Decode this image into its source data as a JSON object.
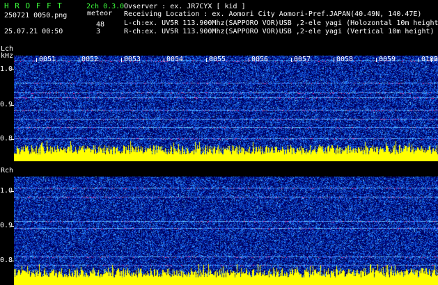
{
  "header": {
    "brand": "H R O F F T",
    "mode": "2ch 0.3.0",
    "filename": "250721 0050.png",
    "meteor_label": "meteor",
    "meteor_count_l": "48",
    "meteor_count_r": "3",
    "datetime": "25.07.21 00:50",
    "observer_line": "Ovserver              : ex. JR7CYX [ kid ]",
    "location_line": "Receiving Location : ex. Aomori City Aomori-Pref.JAPAN(40.49N, 140.47E)",
    "lch_line": "L-ch:ex. UV5R 113.900Mhz(SAPPORO VOR)USB ,2-ele yagi (Holozontal 10m height",
    "rch_line": "R-ch:ex. UV5R 113.900Mhz(SAPPORO VOR)USB ,2-ele yagi (Vertical 10m height)"
  },
  "lch_panel": {
    "label": "Lch",
    "unit": "kHz",
    "ticks": [
      "1.0",
      "0.9",
      "0.8"
    ],
    "time_marks": [
      "0051",
      "0052",
      "0053",
      "0054",
      "0055",
      "0056",
      "0057",
      "0058",
      "0059",
      "0100"
    ],
    "edge_mark": "2"
  },
  "rch_panel": {
    "label": "Rch",
    "ticks": [
      "1.0",
      "0.9",
      "0.8"
    ]
  },
  "colors": {
    "background": "#000000",
    "noise_low": "#00008c",
    "noise_high": "#1464ff",
    "signal_line": "#64c8ff",
    "carrier": "#ff3ca0",
    "level_bars": "#ffff00",
    "label_green": "#3cff3c"
  }
}
